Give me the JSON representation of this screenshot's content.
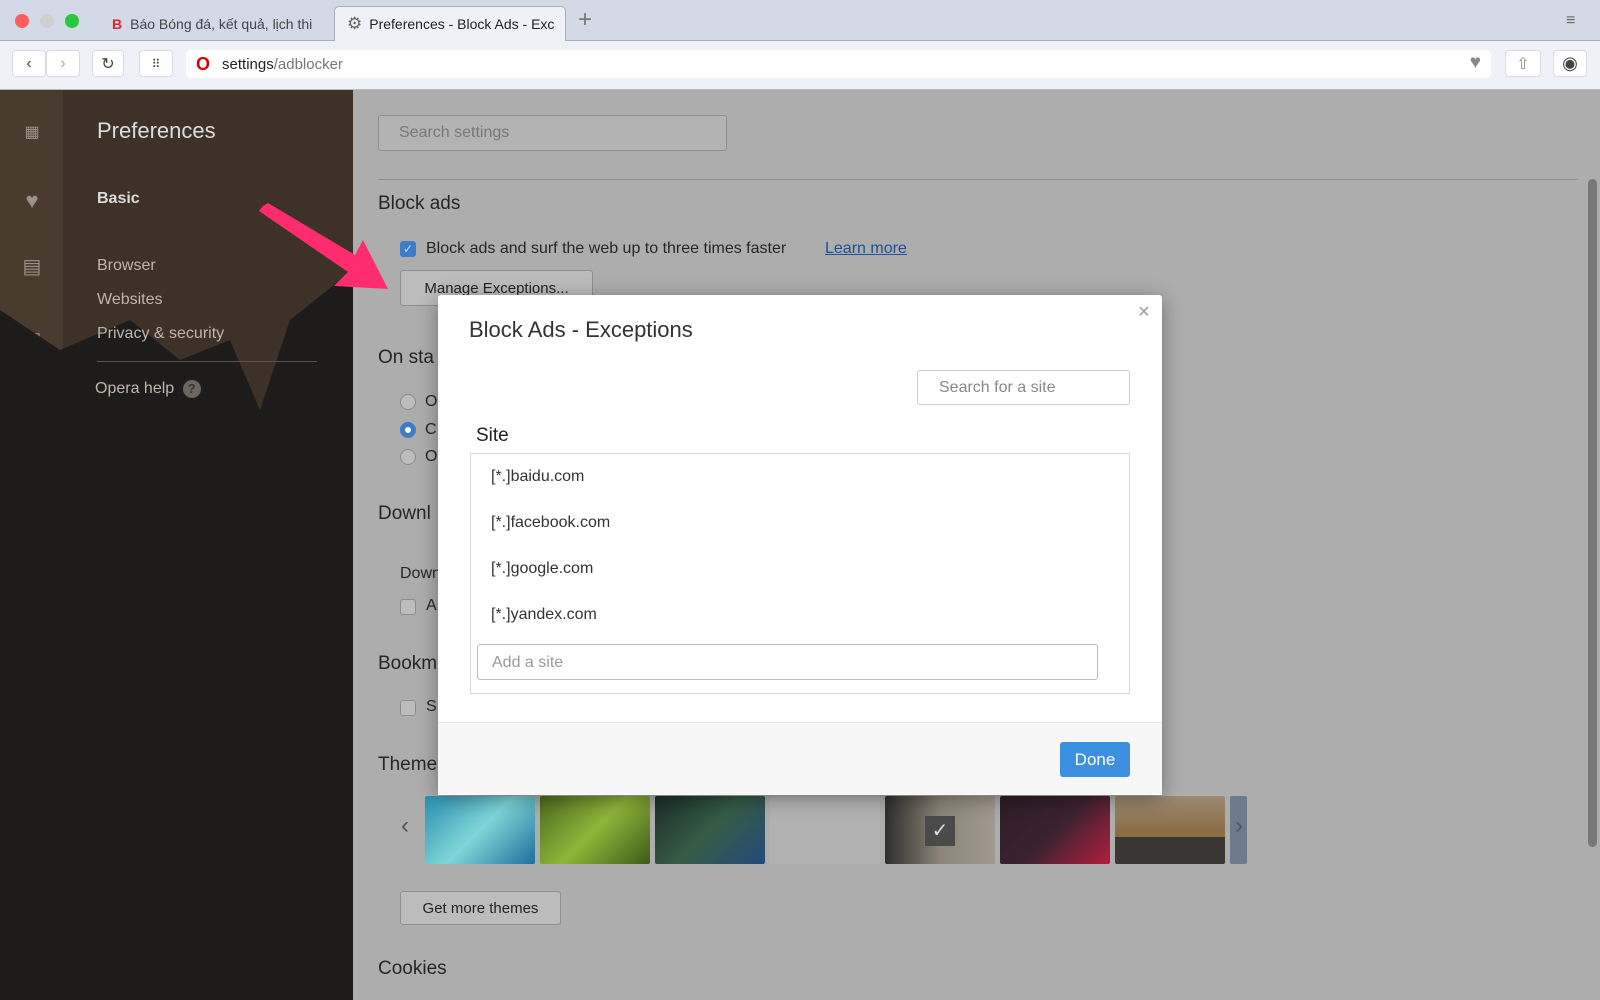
{
  "browser": {
    "tabs": [
      {
        "label": "Báo Bóng đá, kết quả, lịch thi",
        "icon": "bongda-favicon"
      },
      {
        "label": "Preferences - Block Ads - Exc",
        "icon": "gear-icon"
      }
    ],
    "new_tab": "+",
    "url_host": "settings",
    "url_path": "/adblocker"
  },
  "sidebar": {
    "title": "Preferences",
    "items": [
      "Basic",
      "Browser",
      "Websites",
      "Privacy & security"
    ],
    "help": "Opera help",
    "help_icon": "?"
  },
  "content": {
    "search_placeholder": "Search settings",
    "block_ads": {
      "heading": "Block ads",
      "checkbox_label": "Block ads and surf the web up to three times faster",
      "checked": true,
      "learn_more": "Learn more",
      "manage_button": "Manage Exceptions..."
    },
    "partial": {
      "on_startup": "On sta",
      "radio": [
        "O",
        "C",
        "O"
      ],
      "radio_selected": 1,
      "downloads": "Downl",
      "downloads_sub": "Down",
      "downloads_cb": "A",
      "bookmarks": "Bookm",
      "bookmarks_cb": "S",
      "themes": "Theme"
    },
    "themes_selected": 4,
    "get_more_themes": "Get more themes",
    "cookies": "Cookies"
  },
  "dialog": {
    "title": "Block Ads - Exceptions",
    "close": "×",
    "search_placeholder": "Search for a site",
    "column": "Site",
    "sites": [
      "[*.]baidu.com",
      "[*.]facebook.com",
      "[*.]google.com",
      "[*.]yandex.com"
    ],
    "add_placeholder": "Add a site",
    "done": "Done"
  },
  "colors": {
    "accent": "#3d8fe0",
    "annotation_arrow": "#ff2d6f",
    "link": "#1a5fb4"
  }
}
